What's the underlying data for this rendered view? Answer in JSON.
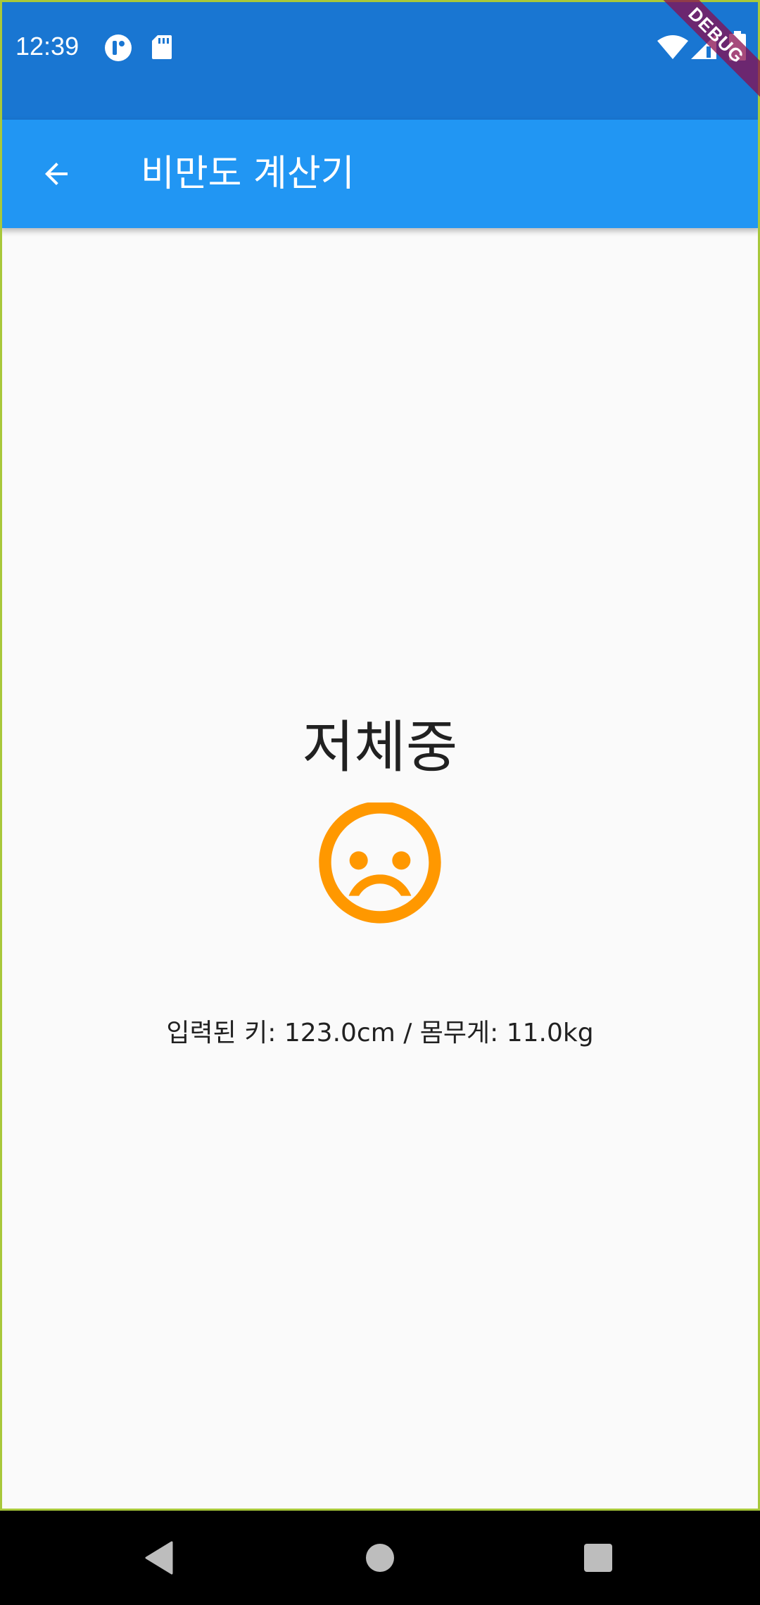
{
  "status_bar": {
    "time": "12:39",
    "icons": [
      "notification-app-icon",
      "sd-card-icon",
      "wifi-icon",
      "cell-signal-icon",
      "battery-icon"
    ]
  },
  "debug_banner": "DEBUG",
  "app_bar": {
    "title": "비만도 계산기",
    "back_icon": "arrow-back-icon"
  },
  "result": {
    "label": "저체중",
    "icon": "sentiment-dissatisfied-icon",
    "icon_color": "#FF9800",
    "summary": "입력된 키: 123.0cm / 몸무게: 11.0kg"
  },
  "colors": {
    "status_bar": "#1976D2",
    "app_bar": "#2196F3",
    "background": "#FAFAFA"
  },
  "nav_bar": {
    "buttons": [
      "back-triangle-icon",
      "home-circle-icon",
      "recents-square-icon"
    ]
  }
}
